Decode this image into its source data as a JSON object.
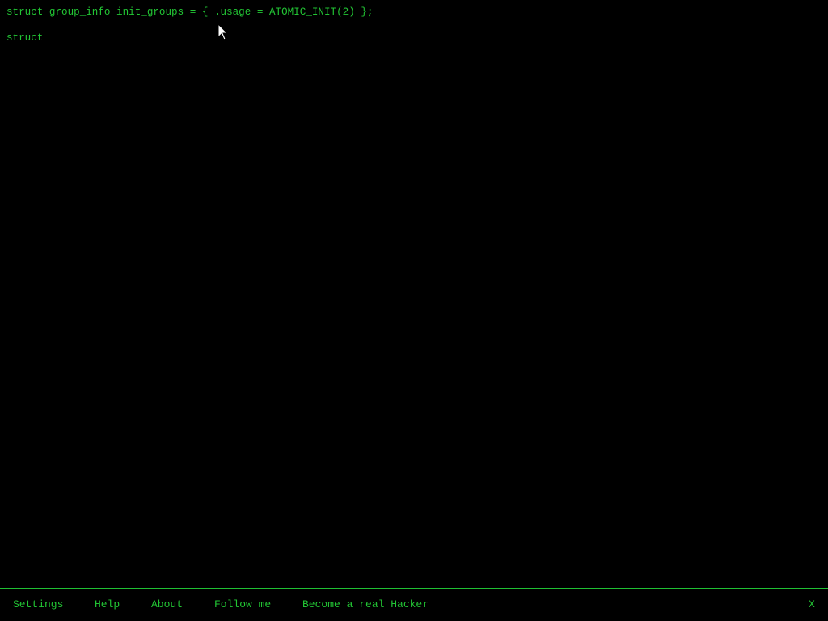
{
  "terminal": {
    "lines": [
      "struct group_info init_groups = { .usage = ATOMIC_INIT(2) };",
      "struct"
    ]
  },
  "menu": {
    "settings": "Settings",
    "help": "Help",
    "about": "About",
    "follow_me": "Follow me",
    "become_hacker": "Become a real Hacker",
    "close": "X"
  },
  "colors": {
    "background": "#000000",
    "text": "#22c534",
    "border": "#1fbf33"
  },
  "icons": {
    "cursor": "mouse-pointer-icon"
  }
}
